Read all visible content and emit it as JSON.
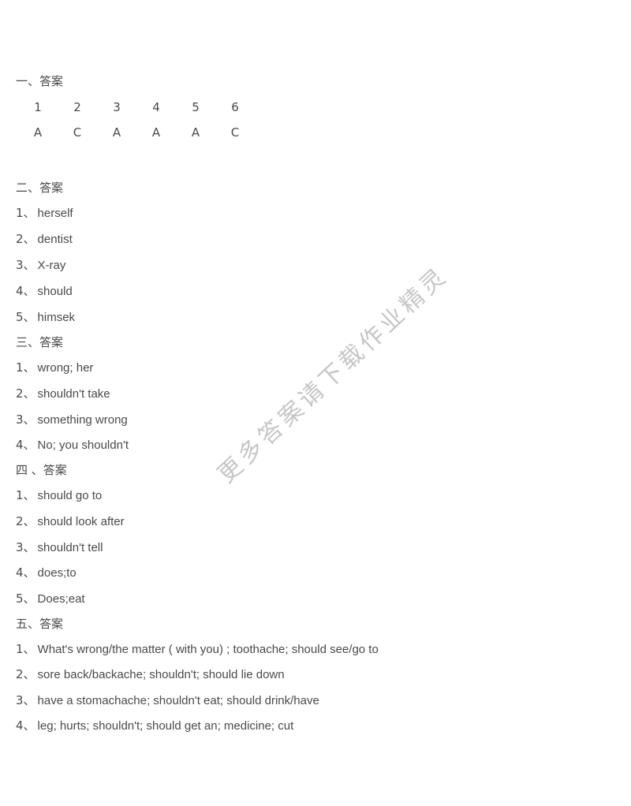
{
  "document": {
    "background_color": "#ffffff",
    "text_color": "#4a4a4a"
  },
  "watermark": {
    "text": "更多答案请下载作业精灵",
    "color": "#c3c3c3"
  },
  "sections": [
    {
      "id": "section-1",
      "heading": "一、答案",
      "type": "choice-grid",
      "headers": [
        "1",
        "2",
        "3",
        "4",
        "5",
        "6"
      ],
      "answers": [
        "A",
        "C",
        "A",
        "A",
        "A",
        "C"
      ]
    },
    {
      "id": "section-2",
      "heading": "二、答案",
      "type": "list",
      "items": [
        {
          "num": "1、",
          "text": "herself"
        },
        {
          "num": "2、",
          "text": "dentist"
        },
        {
          "num": "3、",
          "text": "X-ray"
        },
        {
          "num": "4、",
          "text": "should"
        },
        {
          "num": "5、",
          "text": "himsek"
        }
      ]
    },
    {
      "id": "section-3",
      "heading": "三、答案",
      "type": "list",
      "items": [
        {
          "num": "1、",
          "text": "wrong; her"
        },
        {
          "num": "2、",
          "text": "shouldn't take"
        },
        {
          "num": "3、",
          "text": "something wrong"
        },
        {
          "num": "4、",
          "text": "No; you shouldn't"
        }
      ]
    },
    {
      "id": "section-4",
      "heading": "四 、答案",
      "type": "list",
      "items": [
        {
          "num": "1、",
          "text": "should go to"
        },
        {
          "num": "2、",
          "text": "should look after"
        },
        {
          "num": "3、",
          "text": "shouldn't tell"
        },
        {
          "num": "4、",
          "text": "does;to"
        },
        {
          "num": "5、",
          "text": "Does;eat"
        }
      ]
    },
    {
      "id": "section-5",
      "heading": "五、答案",
      "type": "list",
      "items": [
        {
          "num": "1、",
          "text": "What's wrong/the matter ( with you) ;  toothache;  should see/go to"
        },
        {
          "num": "2、",
          "text": "sore back/backache; shouldn't; should lie down"
        },
        {
          "num": "3、",
          "text": "have a stomachache; shouldn't eat; should drink/have"
        },
        {
          "num": "4、",
          "text": "leg; hurts; shouldn't; should get an; medicine; cut"
        }
      ]
    }
  ]
}
